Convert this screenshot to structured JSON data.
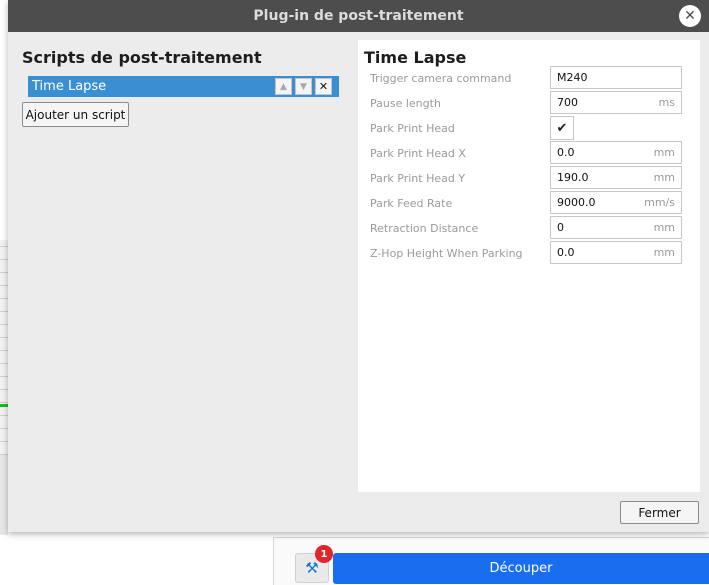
{
  "dialog": {
    "title": "Plug-in de post-traitement",
    "close_icon": "close-icon",
    "close_button": "Fermer"
  },
  "scripts": {
    "heading": "Scripts de post-traitement",
    "items": [
      {
        "label": "Time Lapse",
        "selected": true
      }
    ],
    "add_button": "Ajouter un script"
  },
  "settings": {
    "title": "Time Lapse",
    "rows": [
      {
        "label": "Trigger camera command",
        "value": "M240",
        "unit": ""
      },
      {
        "label": "Pause length",
        "value": "700",
        "unit": "ms"
      },
      {
        "label": "Park Print Head",
        "checked": true
      },
      {
        "label": "Park Print Head X",
        "value": "0.0",
        "unit": "mm"
      },
      {
        "label": "Park Print Head Y",
        "value": "190.0",
        "unit": "mm"
      },
      {
        "label": "Park Feed Rate",
        "value": "9000.0",
        "unit": "mm/s"
      },
      {
        "label": "Retraction Distance",
        "value": "0",
        "unit": "mm"
      },
      {
        "label": "Z-Hop Height When Parking",
        "value": "0.0",
        "unit": "mm"
      }
    ]
  },
  "app": {
    "slice_button": "Découper",
    "notification_count": "1"
  },
  "colors": {
    "accent": "#196ef0",
    "selection": "#3a8fd3",
    "titlebar": "#4d4d4d"
  }
}
